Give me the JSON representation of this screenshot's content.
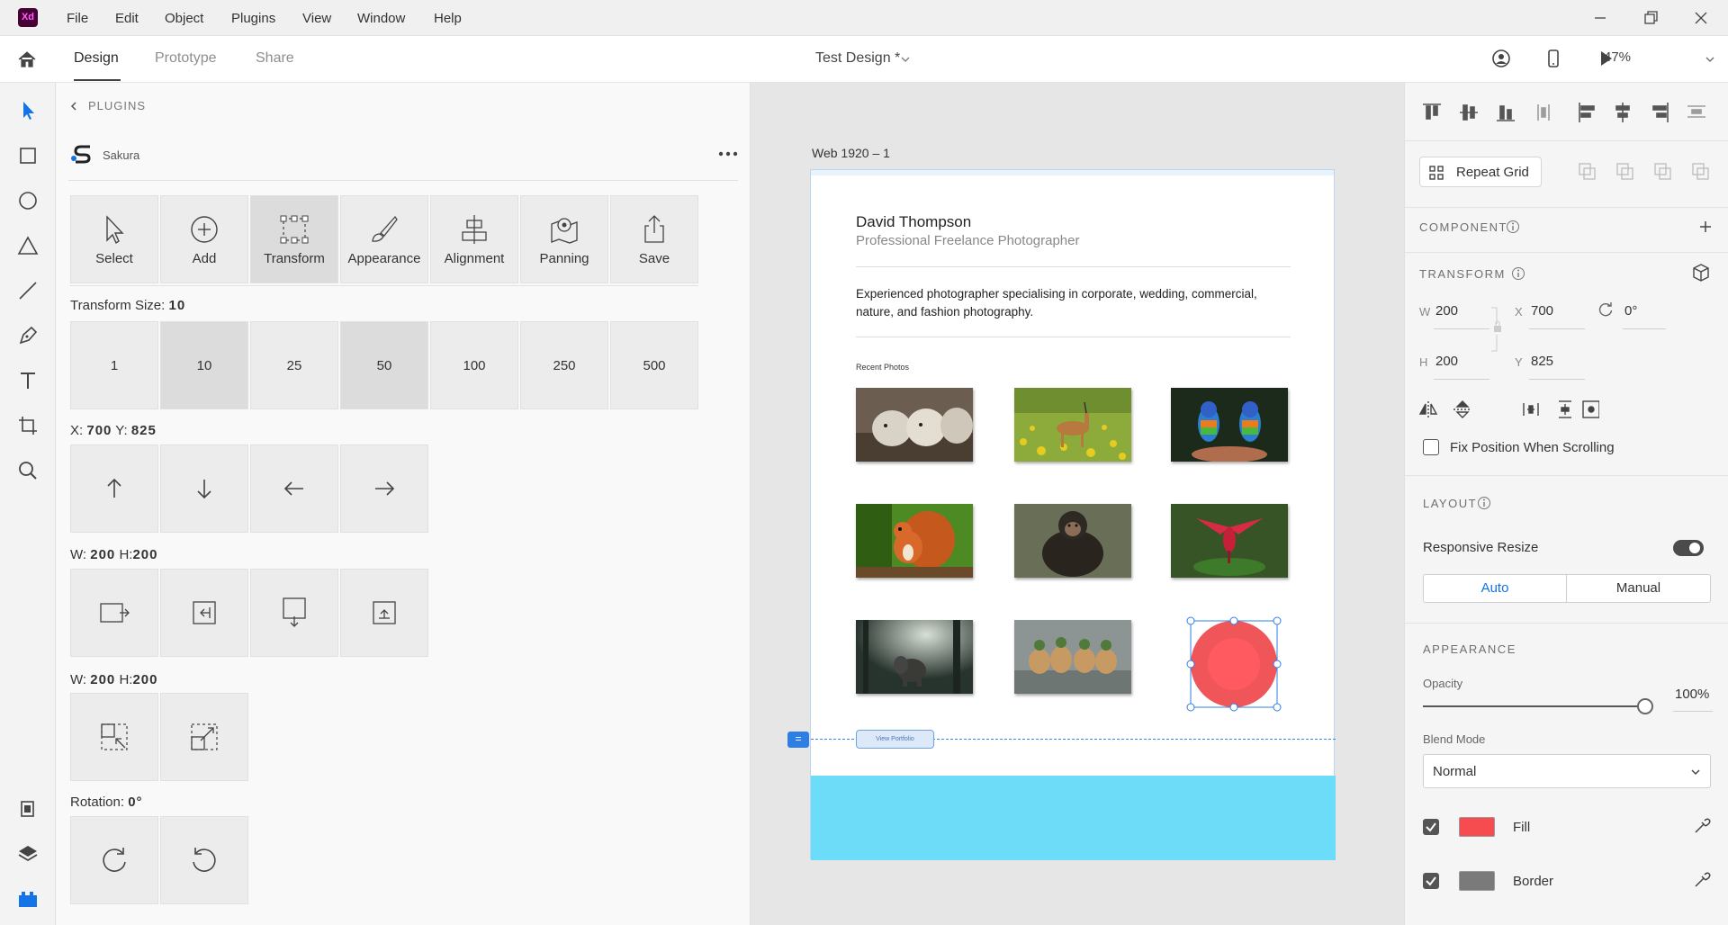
{
  "menubar": {
    "logo": "Xd",
    "items": [
      "File",
      "Edit",
      "Object",
      "Plugins",
      "View",
      "Window",
      "Help"
    ]
  },
  "tabs": {
    "design": "Design",
    "prototype": "Prototype",
    "share": "Share",
    "document_title": "Test Design *",
    "zoom": "47%"
  },
  "plugin_panel": {
    "back_label": "PLUGINS",
    "plugin_name": "Sakura",
    "actions": [
      "Select",
      "Add",
      "Transform",
      "Appearance",
      "Alignment",
      "Panning",
      "Save"
    ],
    "transform_size_label": "Transform Size:",
    "transform_size_value": "10",
    "sizes": [
      "1",
      "10",
      "25",
      "50",
      "100",
      "250",
      "500"
    ],
    "position_label_x": "X:",
    "position_x": "700",
    "position_label_y": "Y:",
    "position_y": "825",
    "resize1_w_label": "W:",
    "resize1_w": "200",
    "resize1_h_label": "H:",
    "resize1_h": "200",
    "resize2_w_label": "W:",
    "resize2_w": "200",
    "resize2_h_label": "H:",
    "resize2_h": "200",
    "rotation_label": "Rotation:",
    "rotation_value": "0°"
  },
  "canvas": {
    "artboard_name": "Web 1920 – 1",
    "name": "David Thompson",
    "subtitle": "Professional Freelance Photographer",
    "description": "Experienced photographer specialising in corporate, wedding, commercial, nature, and fashion photography.",
    "recent_label": "Recent Photos",
    "view_portfolio": "View Portfolio",
    "photos": [
      "sheep",
      "antelope",
      "parrots",
      "squirrel",
      "chimpanzee",
      "red-bird",
      "elephant",
      "ducks"
    ],
    "selected_fill": "#f0555a",
    "footer_color": "#6ddcf8"
  },
  "properties": {
    "repeat_grid": "Repeat Grid",
    "component_label": "COMPONENT",
    "transform_label": "TRANSFORM",
    "w_label": "W",
    "w": "200",
    "x_label": "X",
    "x": "700",
    "rotation": "0°",
    "h_label": "H",
    "h": "200",
    "y_label": "Y",
    "y": "825",
    "fix_position": "Fix Position When Scrolling",
    "layout_label": "LAYOUT",
    "responsive_resize": "Responsive Resize",
    "responsive_resize_on": true,
    "auto": "Auto",
    "manual": "Manual",
    "appearance_label": "APPEARANCE",
    "opacity_label": "Opacity",
    "opacity_value": "100%",
    "blend_label": "Blend Mode",
    "blend_value": "Normal",
    "fill_label": "Fill",
    "fill_color": "#f64b4f",
    "border_label": "Border",
    "border_color": "#7a7a7a"
  }
}
